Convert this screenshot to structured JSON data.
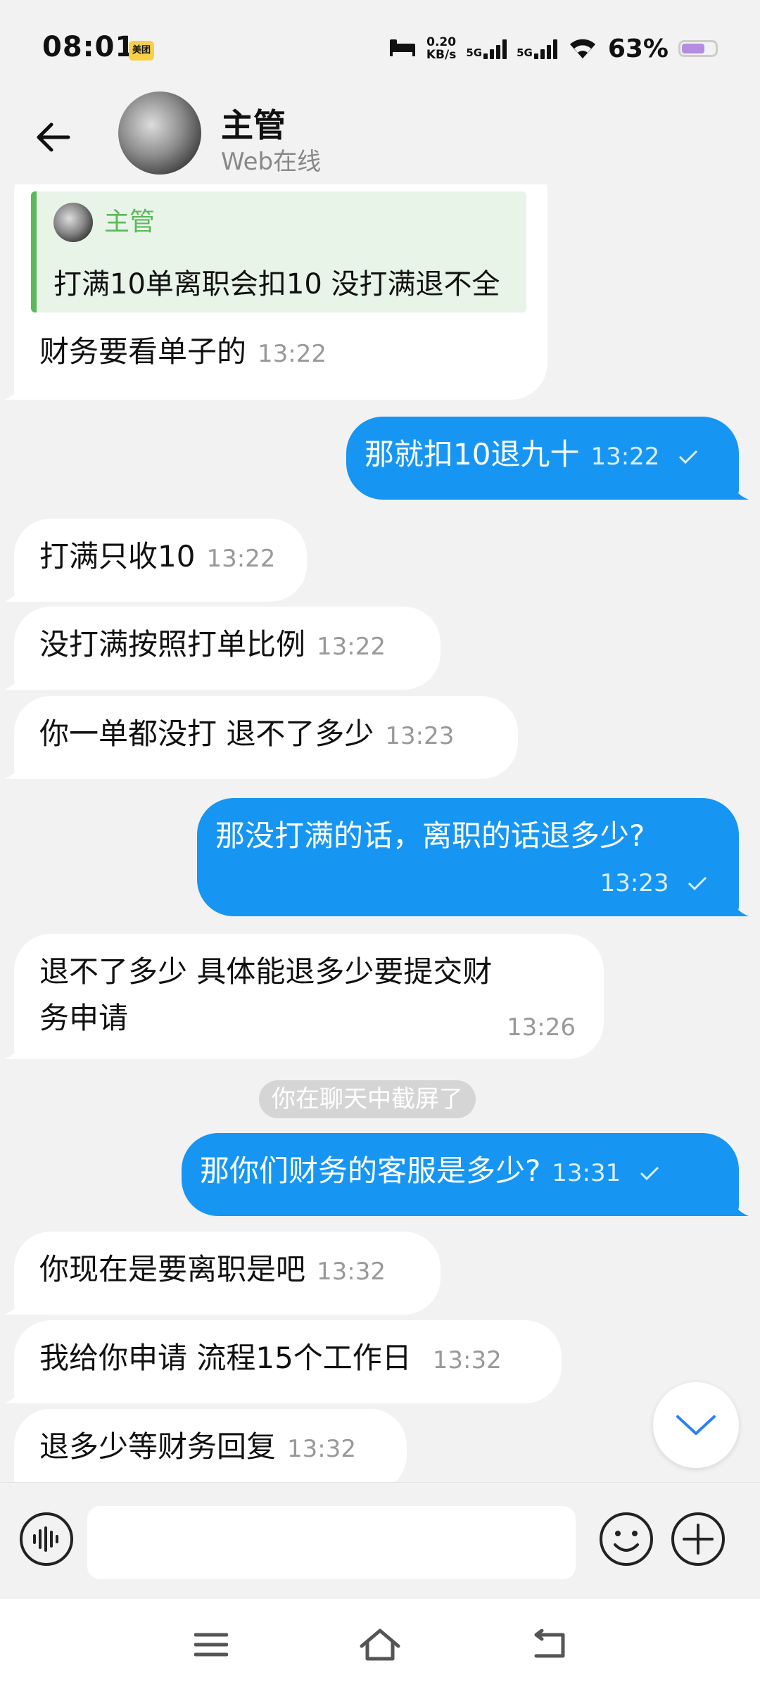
{
  "status_bar": {
    "time": "08:01",
    "app_badge": "美团",
    "net_speed_top": "0.20",
    "net_speed_bottom": "KB/s",
    "sim1": "5G",
    "sim2": "5G",
    "battery_pct": "63%",
    "battery_level": 0.63
  },
  "header": {
    "name": "主管",
    "status": "Web在线"
  },
  "messages": [
    {
      "dir": "in",
      "quote_name": "主管",
      "quote_text": "打满10单离职会扣10  没打满退不全",
      "text": "财务要看单子的",
      "time": "13:22"
    },
    {
      "dir": "out",
      "text": "那就扣10退九十",
      "time": "13:22"
    },
    {
      "dir": "in",
      "text": "打满只收10",
      "time": "13:22"
    },
    {
      "dir": "in",
      "text": "没打满按照打单比例",
      "time": "13:22"
    },
    {
      "dir": "in",
      "text": "你一单都没打 退不了多少",
      "time": "13:23"
    },
    {
      "dir": "out",
      "text": "那没打满的话，离职的话退多少?",
      "time": "13:23"
    },
    {
      "dir": "in",
      "text_line1": "退不了多少 具体能退多少要提交财",
      "text_line2": "务申请",
      "time": "13:26"
    },
    {
      "dir": "out",
      "text": "那你们财务的客服是多少?",
      "time": "13:31"
    },
    {
      "dir": "in",
      "text": "你现在是要离职是吧",
      "time": "13:32"
    },
    {
      "dir": "in",
      "text": "我给你申请 流程15个工作日",
      "time": "13:32"
    },
    {
      "dir": "in",
      "text": "退多少等财务回复",
      "time": "13:32"
    }
  ],
  "system_notice": "你在聊天中截屏了",
  "input": {
    "placeholder": "",
    "value": ""
  },
  "icons": {
    "back": "back-arrow-icon",
    "voice": "voice-icon",
    "emoji": "emoji-icon",
    "plus": "plus-icon",
    "scroll_down": "chevron-down-icon",
    "nav_menu": "menu-icon",
    "nav_home": "home-icon",
    "nav_back": "nav-back-icon"
  },
  "colors": {
    "outgoing_bubble": "#1696f2",
    "incoming_bubble": "#ffffff",
    "quote_accent": "#5cb85c",
    "background": "#f2f2f2"
  }
}
